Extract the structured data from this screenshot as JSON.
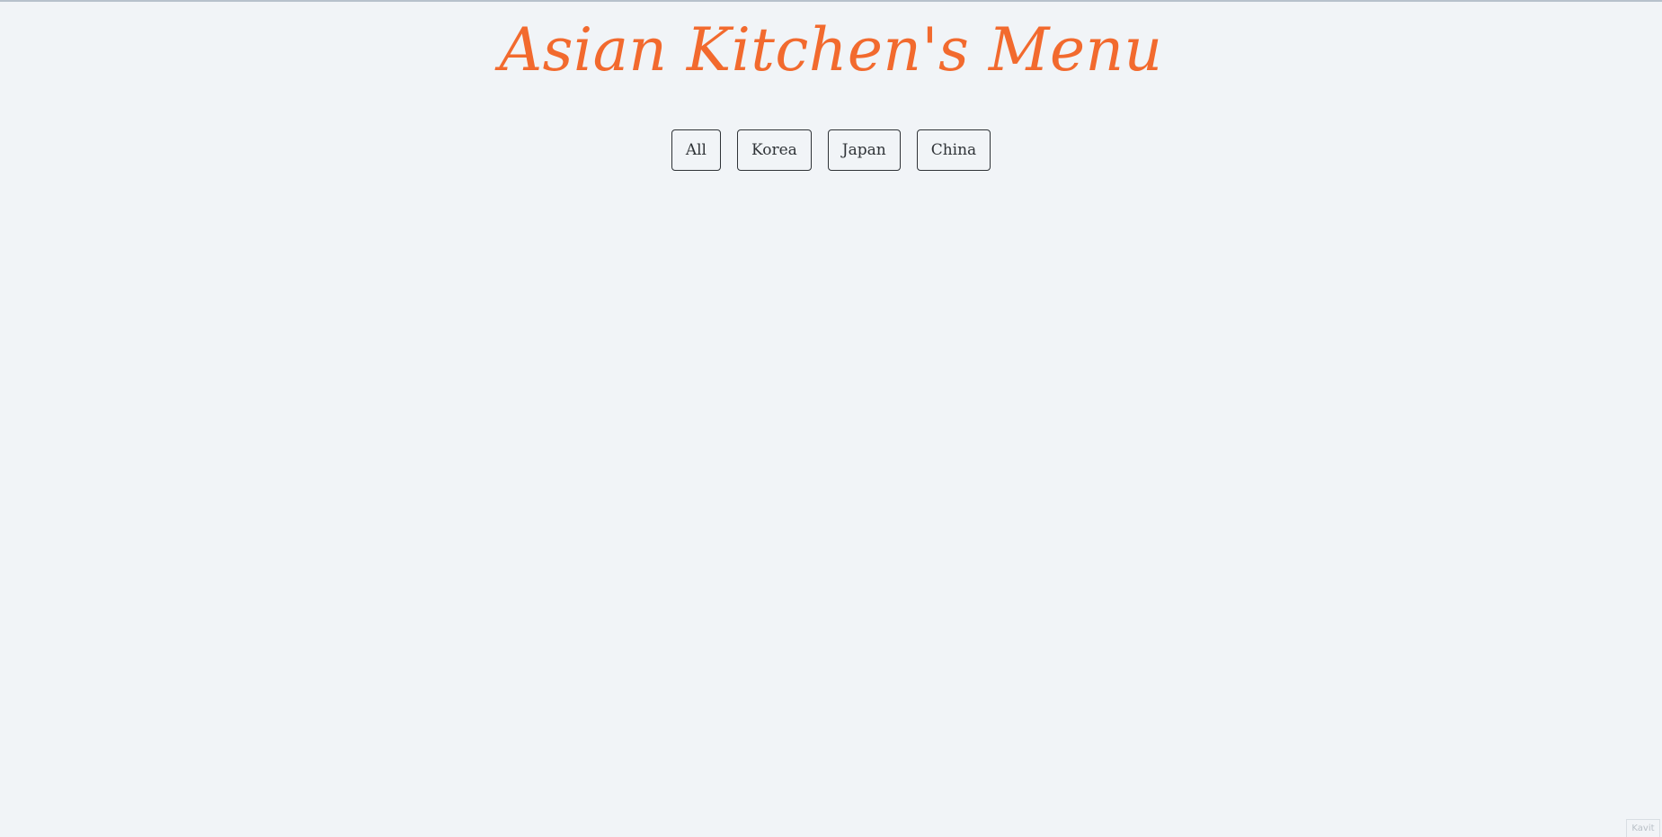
{
  "header": {
    "title": "Asian Kitchen's Menu"
  },
  "filters": {
    "buttons": [
      {
        "label": "All"
      },
      {
        "label": "Korea"
      },
      {
        "label": "Japan"
      },
      {
        "label": "China"
      }
    ]
  },
  "footer": {
    "mark": "Kavit"
  },
  "colors": {
    "background": "#f1f4f7",
    "title": "#f26a2e",
    "button_border": "#2f3337"
  }
}
